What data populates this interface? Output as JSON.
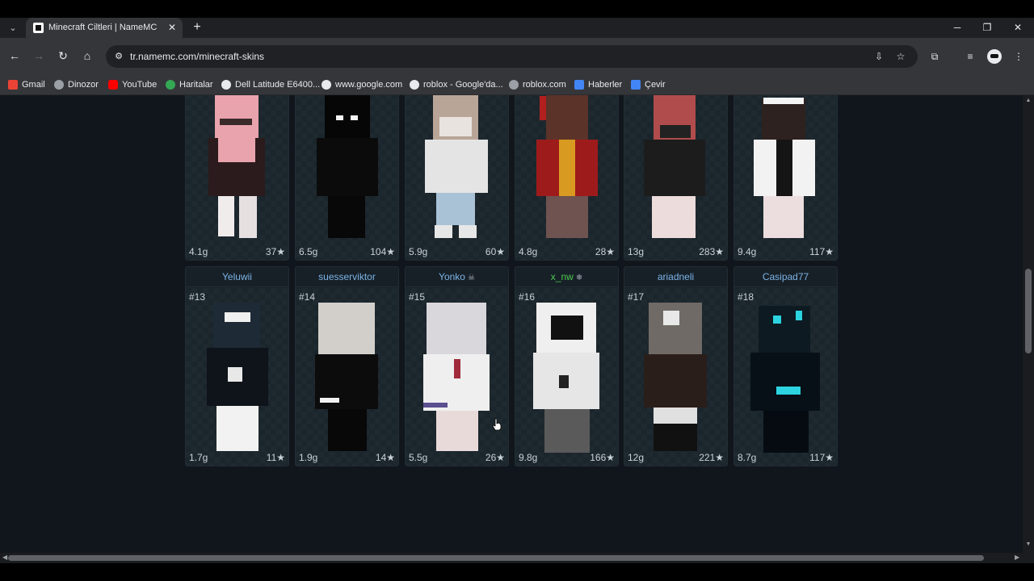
{
  "browser": {
    "tab_title": "Minecraft Ciltleri | NameMC",
    "tab_dropdown_icon": "chevron-down-icon",
    "new_tab_label": "+",
    "url_host": "tr.namemc.com",
    "url_path": "/minecraft-skins",
    "window_controls": {
      "minimize": "─",
      "restore": "❐",
      "close": "✕"
    }
  },
  "bookmarks": [
    {
      "label": "Gmail",
      "color": "#ea4335"
    },
    {
      "label": "Dinozor",
      "color": "#9aa0a6"
    },
    {
      "label": "YouTube",
      "color": "#ff0000"
    },
    {
      "label": "Haritalar",
      "color": "#34a853"
    },
    {
      "label": "Dell Latitude E6400...",
      "color": "#e8eaed"
    },
    {
      "label": "www.google.com",
      "color": "#e8eaed"
    },
    {
      "label": "roblox - Google'da...",
      "color": "#e8eaed"
    },
    {
      "label": "roblox.com",
      "color": "#9aa0a6"
    },
    {
      "label": "Haberler",
      "color": "#4285f4"
    },
    {
      "label": "Çevir",
      "color": "#4285f4"
    }
  ],
  "top_row": [
    {
      "size": "4.1g",
      "stars": "37★"
    },
    {
      "size": "6.5g",
      "stars": "104★"
    },
    {
      "size": "5.9g",
      "stars": "60★"
    },
    {
      "size": "4.8g",
      "stars": "28★"
    },
    {
      "size": "13g",
      "stars": "283★"
    },
    {
      "size": "9.4g",
      "stars": "117★"
    }
  ],
  "bottom_row": [
    {
      "name": "Yeluwii",
      "badge": "",
      "rank": "#13",
      "size": "1.7g",
      "stars": "11★"
    },
    {
      "name": "suesserviktor",
      "badge": "",
      "rank": "#14",
      "size": "1.9g",
      "stars": "14★"
    },
    {
      "name": "Yonko",
      "badge": "☠",
      "rank": "#15",
      "size": "5.5g",
      "stars": "26★"
    },
    {
      "name": "x_nw",
      "badge": "❄",
      "rank": "#16",
      "size": "9.8g",
      "stars": "166★"
    },
    {
      "name": "ariadneli",
      "badge": "",
      "rank": "#17",
      "size": "12g",
      "stars": "221★"
    },
    {
      "name": "Casipad77",
      "badge": "",
      "rank": "#18",
      "size": "8.7g",
      "stars": "117★"
    }
  ],
  "colors": {
    "page_bg": "#10161b",
    "link_blue": "#7cb3e6",
    "green_name": "#4fc84f"
  }
}
